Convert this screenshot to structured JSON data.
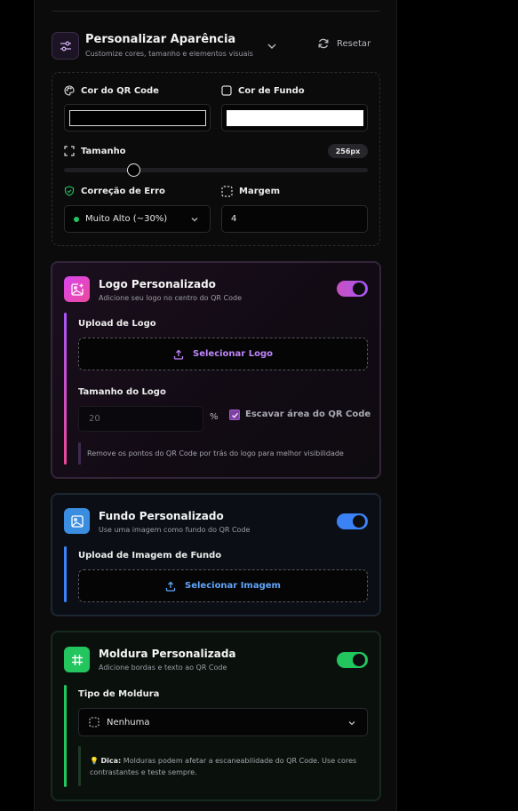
{
  "header": {
    "title": "Personalizar Aparência",
    "subtitle": "Customize cores, tamanho e elementos visuais",
    "reset_label": "Resetar"
  },
  "settings": {
    "qr_color_label": "Cor do QR Code",
    "bg_color_label": "Cor de Fundo",
    "qr_color": "#000000",
    "bg_color": "#ffffff",
    "size_label": "Tamanho",
    "size_value": "256px",
    "size_fraction": 0.23,
    "error_label": "Correção de Erro",
    "error_value": "Muito Alto (~30%)",
    "margin_label": "Margem",
    "margin_value": "4"
  },
  "logo_card": {
    "title": "Logo Personalizado",
    "subtitle": "Adicione seu logo no centro do QR Code",
    "enabled": true,
    "upload_label": "Upload de Logo",
    "upload_button": "Selecionar Logo",
    "size_label": "Tamanho do Logo",
    "size_placeholder": "20",
    "size_unit": "%",
    "excavate_label": "Escavar área do QR Code",
    "excavate_checked": true,
    "excavate_note": "Remove os pontos do QR Code por trás do logo para melhor visibilidade",
    "accent": "#c850c0"
  },
  "bg_card": {
    "title": "Fundo Personalizado",
    "subtitle": "Use uma imagem como fundo do QR Code",
    "enabled": true,
    "upload_label": "Upload de Imagem de Fundo",
    "upload_button": "Selecionar Imagem",
    "accent": "#3b82f6"
  },
  "frame_card": {
    "title": "Moldura Personalizada",
    "subtitle": "Adicione bordas e texto ao QR Code",
    "enabled": true,
    "type_label": "Tipo de Moldura",
    "type_value": "Nenhuma",
    "tip_bold": "Dica:",
    "tip_text": "Molduras podem afetar a escaneabilidade do QR Code. Use cores contrastantes e teste sempre.",
    "accent": "#22c55e"
  },
  "icons": [
    "sliders-icon",
    "chevron-down-icon",
    "refresh-icon",
    "palette-icon",
    "square-icon",
    "expand-icon",
    "shield-check-icon",
    "dashed-square-icon",
    "image-plus-icon",
    "upload-icon",
    "checkbox-icon",
    "image-icon",
    "hash-icon",
    "lightbulb-icon"
  ]
}
